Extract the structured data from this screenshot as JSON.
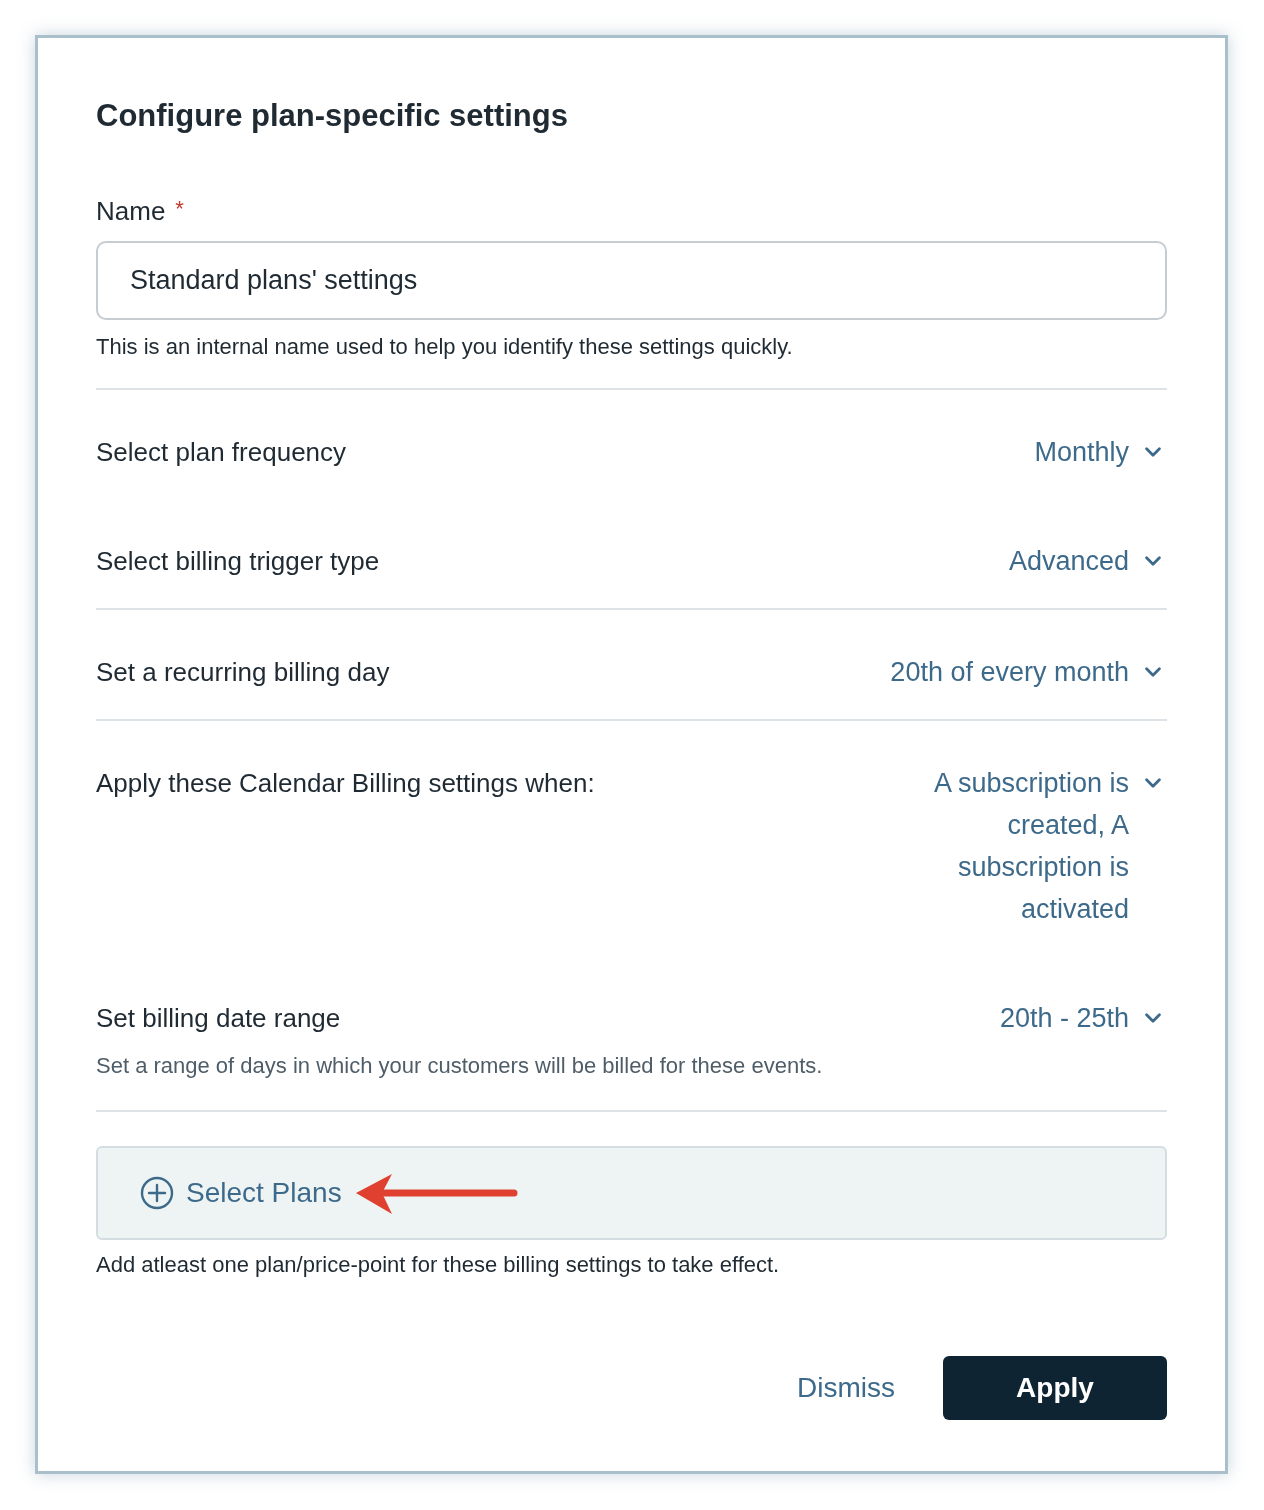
{
  "dialog": {
    "title": "Configure plan-specific settings",
    "name_field": {
      "label": "Name",
      "required_marker": "*",
      "value": "Standard plans' settings",
      "help": "This is an internal name used to help you identify these settings quickly."
    },
    "sections": [
      {
        "rows": [
          {
            "label": "Select plan frequency",
            "value": "Monthly"
          },
          {
            "label": "Select billing trigger type",
            "value": "Advanced"
          }
        ]
      },
      {
        "rows": [
          {
            "label": "Set a recurring billing day",
            "value": "20th of every month"
          }
        ]
      },
      {
        "rows": [
          {
            "label": "Apply these Calendar Billing settings when:",
            "value": "A subscription is created, A subscription is activated"
          },
          {
            "label": "Set billing date range",
            "value": "20th - 25th",
            "description": "Set a range of days in which your customers will be billed for these events."
          }
        ]
      }
    ],
    "select_plans": {
      "label": "Select Plans",
      "help": "Add atleast one plan/price-point for these billing settings to take effect."
    },
    "buttons": [
      {
        "label": "Dismiss",
        "kind": "link"
      },
      {
        "label": "Apply",
        "kind": "primary"
      }
    ]
  }
}
